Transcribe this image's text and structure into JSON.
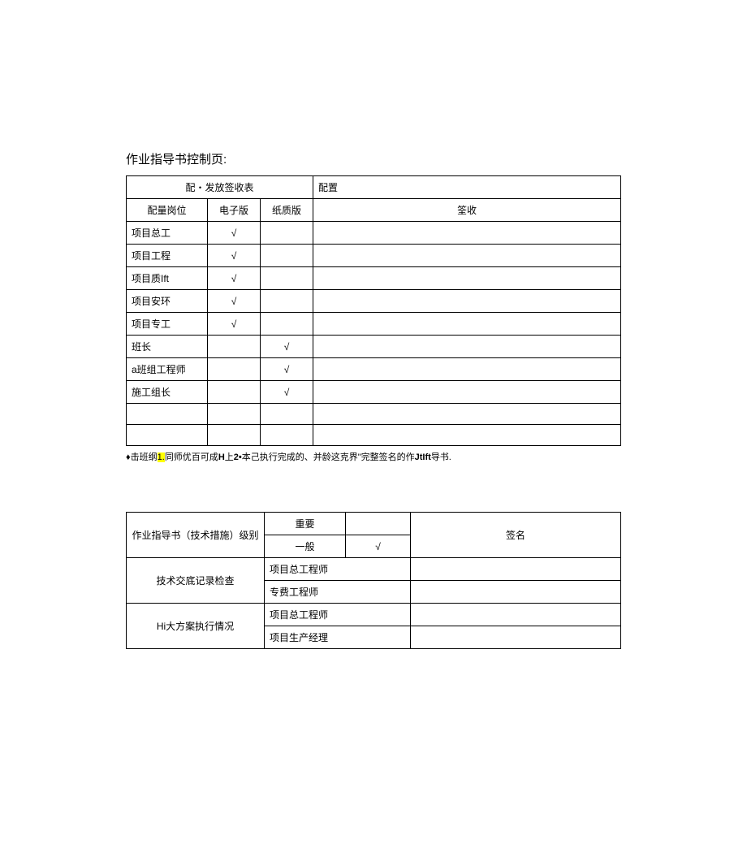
{
  "title": "作业指导书控制页:",
  "table1": {
    "header_merge": "配・发放签收表",
    "header_config": "配置",
    "cols": {
      "position": "配量岗位",
      "electronic": "电子版",
      "paper": "纸质版",
      "sign": "筌收"
    },
    "rows": [
      {
        "position": "项目总工",
        "electronic": "√",
        "paper": "",
        "sign": ""
      },
      {
        "position": "项目工程",
        "electronic": "√",
        "paper": "",
        "sign": ""
      },
      {
        "position": "项目质Ift",
        "electronic": "√",
        "paper": "",
        "sign": ""
      },
      {
        "position": "项目安环",
        "electronic": "√",
        "paper": "",
        "sign": ""
      },
      {
        "position": "项目专工",
        "electronic": "√",
        "paper": "",
        "sign": ""
      },
      {
        "position": "班长",
        "electronic": "",
        "paper": "√",
        "sign": ""
      },
      {
        "position": "a班组工程师",
        "electronic": "",
        "paper": "√",
        "sign": ""
      },
      {
        "position": "施工组长",
        "electronic": "",
        "paper": "√",
        "sign": ""
      }
    ]
  },
  "note_prefix": "♦击班纲",
  "note_hl": "1.",
  "note_mid": "同师优百可成",
  "note_bold1": "H",
  "note_mid2": "上",
  "note_bold2": "2•",
  "note_mid3": "本己执行完成的、并龄这克界\"完整签名的作",
  "note_bold3": "JtIft",
  "note_end": "导书.",
  "table2": {
    "level_label": "作业指导书（技术措施）级别",
    "important": "重要",
    "general": "一般",
    "general_check": "√",
    "sign": "签名",
    "tech_check": "技术交底记录检查",
    "proj_chief": "项目总工程师",
    "spec_eng": "专费工程师",
    "hi_plan": "Hi大方案执行情况",
    "prod_mgr": "项目生产经理"
  }
}
